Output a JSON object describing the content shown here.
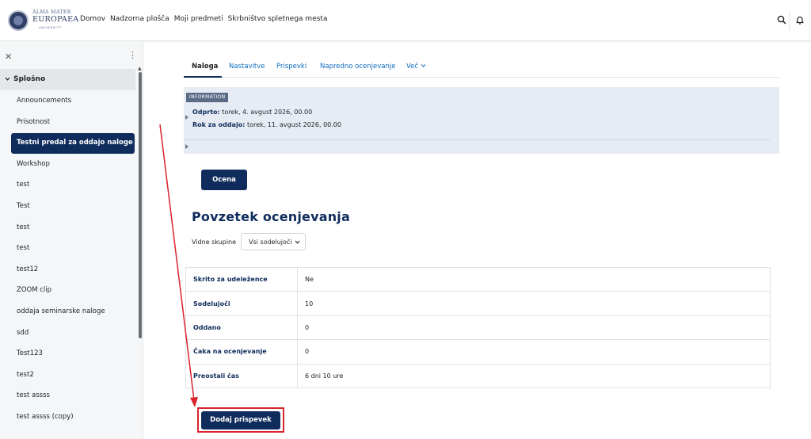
{
  "header": {
    "logo": {
      "line1": "ALMA MATER",
      "line2": "EUROPAEA",
      "line3": "UNIVERSITY"
    },
    "nav": [
      "Domov",
      "Nadzorna plošča",
      "Moji predmeti",
      "Skrbništvo spletnega mesta"
    ],
    "icons": [
      "search-icon",
      "bell-icon"
    ]
  },
  "sidebar": {
    "section": "Splošno",
    "items": [
      "Announcements",
      "Prisotnost",
      "Testni predal za oddajo naloge",
      "Workshop",
      "test",
      "Test",
      "test",
      "test",
      "test12",
      "ZOOM clip",
      "oddaja seminarske naloge",
      "sdd",
      "Test123",
      "test2",
      "test assss",
      "test assss (copy)"
    ],
    "active_index": 2
  },
  "tabs": [
    "Naloga",
    "Nastavitve",
    "Prispevki",
    "Napredno ocenjevanje",
    "Več"
  ],
  "info": {
    "badge": "INFORMATION",
    "opened_label": "Odprto:",
    "opened_value": "torek, 4. avgust 2026, 00.00",
    "due_label": "Rok za oddajo:",
    "due_value": "torek, 11. avgust 2026, 00.00"
  },
  "grade_button": "Ocena",
  "summary": {
    "title": "Povzetek ocenjevanja",
    "groups_label": "Vidne skupine",
    "groups_value": "Vsi sodelujoči",
    "rows": [
      {
        "k": "Skrito za udeležence",
        "v": "Ne"
      },
      {
        "k": "Sodelujoči",
        "v": "10"
      },
      {
        "k": "Oddano",
        "v": "0"
      },
      {
        "k": "Čaka na ocenjevanje",
        "v": "0"
      },
      {
        "k": "Preostali čas",
        "v": "6 dni 10 ure"
      }
    ]
  },
  "submit_button": "Dodaj prispevek",
  "colors": {
    "primary": "#0f2c5c",
    "annotation": "#d9232d",
    "info_bg": "#e7ecf4"
  }
}
